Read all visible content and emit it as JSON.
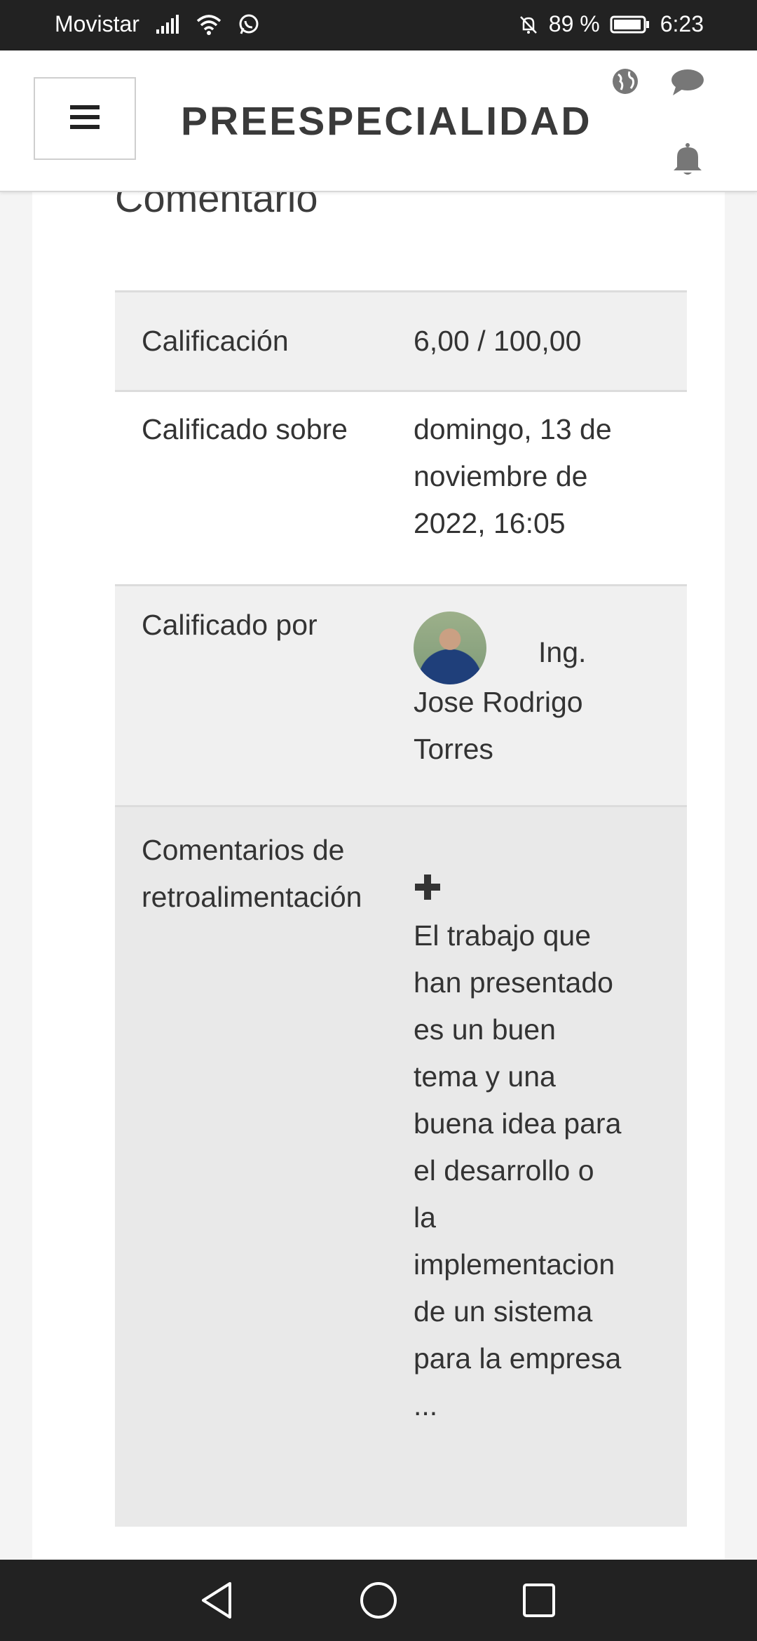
{
  "statusbar": {
    "carrier": "Movistar",
    "battery": "89 %",
    "time": "6:23"
  },
  "header": {
    "title": "PREESPECIALIDAD"
  },
  "section": {
    "title": "Comentario"
  },
  "grade": {
    "calificacion_label": "Calificación",
    "calificacion_value": "6,00 / 100,00",
    "calificado_sobre_label": "Calificado sobre",
    "calificado_sobre_line1": "domingo, 13 de",
    "calificado_sobre_line2": "noviembre de",
    "calificado_sobre_line3": "2022, 16:05",
    "calificado_por_label": "Calificado por",
    "grader_title": "Ing.",
    "grader_line2": "Jose Rodrigo",
    "grader_line3": "Torres",
    "feedback_label_line1": "Comentarios de",
    "feedback_label_line2": "retroalimentación",
    "feedback_lines": [
      "El trabajo que",
      "han presentado",
      "es un buen",
      "tema y una",
      "buena idea para",
      "el desarrollo o",
      "la",
      "implementacion",
      "de un sistema",
      "para la empresa",
      "..."
    ]
  }
}
